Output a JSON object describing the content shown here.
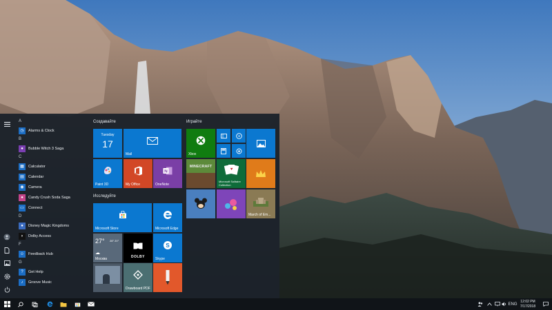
{
  "start_menu": {
    "rail": {
      "menu_icon": "hamburger-icon",
      "bottom_icons": [
        "user-icon",
        "documents-icon",
        "pictures-icon",
        "settings-icon",
        "power-icon"
      ]
    },
    "app_list": {
      "letters": [
        "A",
        "B",
        "C",
        "D",
        "F",
        "G"
      ],
      "apps": [
        {
          "letter": "A",
          "name": "Alarms & Clock",
          "icon": "alarm-clock-icon",
          "color": "#1c6ec5"
        },
        {
          "letter": "B",
          "name": "Bubble Witch 3 Saga",
          "icon": "game-icon",
          "color": "#7a3fb1"
        },
        {
          "letter": "C",
          "name": "Calculator",
          "icon": "calculator-icon",
          "color": "#1c6ec5"
        },
        {
          "letter": "C",
          "name": "Calendar",
          "icon": "calendar-icon",
          "color": "#1c6ec5"
        },
        {
          "letter": "C",
          "name": "Camera",
          "icon": "camera-icon",
          "color": "#1c6ec5"
        },
        {
          "letter": "C",
          "name": "Candy Crush Soda Saga",
          "icon": "game-icon",
          "color": "#c4458a"
        },
        {
          "letter": "C",
          "name": "Connect",
          "icon": "connect-icon",
          "color": "#1c6ec5"
        },
        {
          "letter": "D",
          "name": "Disney Magic Kingdoms",
          "icon": "game-icon",
          "color": "#3a6bbf"
        },
        {
          "letter": "D",
          "name": "Dolby Access",
          "icon": "dolby-icon",
          "color": "#111111"
        },
        {
          "letter": "F",
          "name": "Feedback Hub",
          "icon": "feedback-icon",
          "color": "#1c6ec5"
        },
        {
          "letter": "G",
          "name": "Get Help",
          "icon": "help-icon",
          "color": "#1c6ec5"
        },
        {
          "letter": "G",
          "name": "Groove Music",
          "icon": "music-icon",
          "color": "#1c6ec5"
        }
      ]
    },
    "groups": {
      "create": "Создавайте",
      "play": "Играйте",
      "explore": "Исследуйте"
    },
    "tiles": {
      "calendar": {
        "day": "Tuesday",
        "date": "17"
      },
      "mail": {
        "label": "Mail"
      },
      "paint3d": {
        "label": "Paint 3D"
      },
      "myoffice": {
        "label": "My Office"
      },
      "onenote": {
        "label": "OneNote"
      },
      "xbox": {
        "label": "Xbox"
      },
      "minecraft": {
        "label": "MINECRAFT"
      },
      "solitaire": {
        "label": "Microsoft Solitaire Collection"
      },
      "march": {
        "label": "March of Em..."
      },
      "store": {
        "label": "Microsoft Store"
      },
      "edge": {
        "label": "Microsoft Edge"
      },
      "weather": {
        "temp": "27°",
        "high_low": "28° 20°",
        "city": "Москва"
      },
      "dolby": {
        "label": "DOLBY"
      },
      "skype": {
        "label": "Skype"
      },
      "news": {
        "label": ""
      },
      "drawboard": {
        "label": "Drawboard PDF"
      },
      "sketchbook": {
        "label": "Sketchbook"
      }
    }
  },
  "taskbar": {
    "start_icon": "windows-logo-icon",
    "search_icon": "search-icon",
    "taskview_icon": "task-view-icon",
    "pinned": [
      "edge-icon",
      "file-explorer-icon",
      "store-icon",
      "mail-icon"
    ],
    "tray": {
      "lang": "ENG"
    },
    "clock": {
      "time": "12:02 PM",
      "date": "7/17/2018"
    }
  }
}
